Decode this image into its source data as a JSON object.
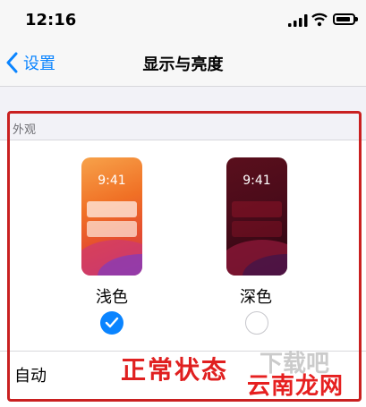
{
  "status_bar": {
    "time": "12:16"
  },
  "nav": {
    "back_label": "设置",
    "title": "显示与亮度"
  },
  "appearance": {
    "section_header": "外观",
    "light": {
      "preview_time": "9:41",
      "label": "浅色",
      "selected": true
    },
    "dark": {
      "preview_time": "9:41",
      "label": "深色",
      "selected": false
    },
    "automatic_label": "自动"
  },
  "annotation": {
    "text": "正常状态",
    "color": "#e02020"
  },
  "watermark": {
    "faint_text": "下载吧",
    "logo_text": "云南龙网"
  },
  "colors": {
    "accent": "#0a84ff",
    "frame": "#c92020"
  }
}
